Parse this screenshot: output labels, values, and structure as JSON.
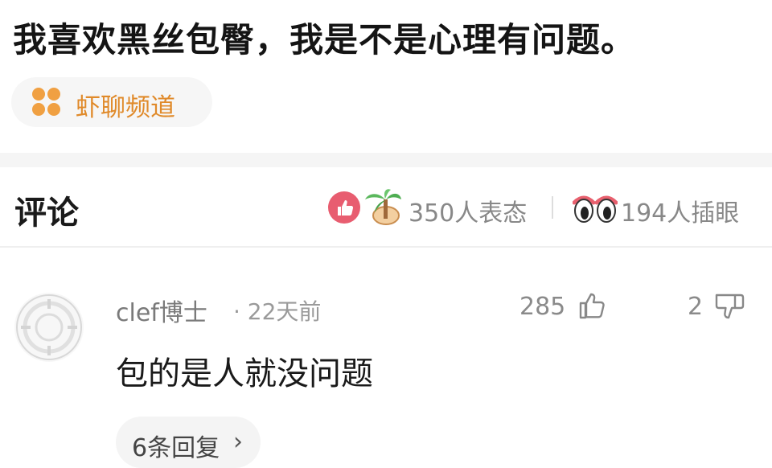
{
  "question": {
    "title": "我喜欢黑丝包臀，我是不是心理有问题。"
  },
  "channel": {
    "label": "虾聊频道",
    "icon": "four-dots-icon",
    "accent": "#f0a042"
  },
  "comments_header": {
    "title": "评论",
    "reaction_summary": "350人表态",
    "eye_summary": "194人插眼"
  },
  "comments": [
    {
      "user": "clef博士",
      "time": "· 22天前",
      "likes": "285",
      "dislikes": "2",
      "text": "包的是人就没问题",
      "replies_label": "6条回复",
      "replies_chevron": "›"
    }
  ]
}
